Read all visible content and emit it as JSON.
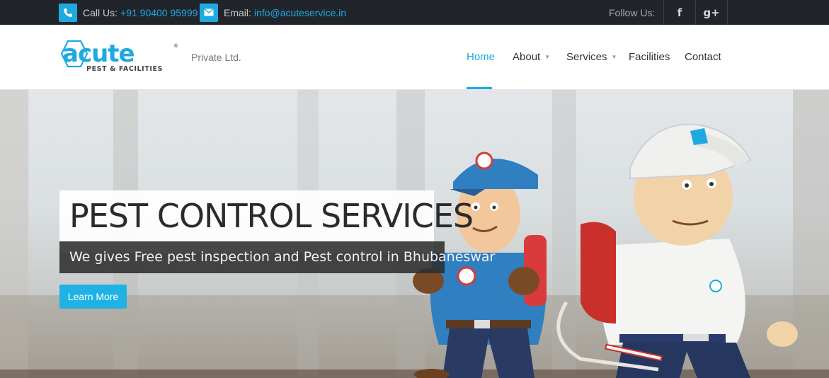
{
  "topbar": {
    "call_label": "Call Us:",
    "phone": "+91 90400 95999",
    "email_label": "Email:",
    "email": "info@acuteservice.in",
    "follow_label": "Follow Us:",
    "social": [
      {
        "icon": "facebook-icon",
        "glyph": "f"
      },
      {
        "icon": "google-plus-icon",
        "glyph": "g+"
      }
    ]
  },
  "brand": {
    "logo_text": "acute",
    "logo_subtext": "PEST & FACILITIES",
    "registered": "®",
    "tagline": "Private Ltd."
  },
  "nav": {
    "items": [
      {
        "label": "Home",
        "active": true
      },
      {
        "label": "About",
        "caret": "▼"
      },
      {
        "label": "Services",
        "caret": "▼"
      },
      {
        "label": "Facilities"
      },
      {
        "label": "Contact"
      }
    ]
  },
  "hero": {
    "title": "PEST CONTROL SERVICES",
    "subtitle": "We gives Free pest inspection and Pest control in Bhubaneswar",
    "cta_label": "Learn More"
  },
  "colors": {
    "accent": "#1fa9e1",
    "topbar_bg": "#21252b",
    "button_bg": "#1fb3e5"
  }
}
